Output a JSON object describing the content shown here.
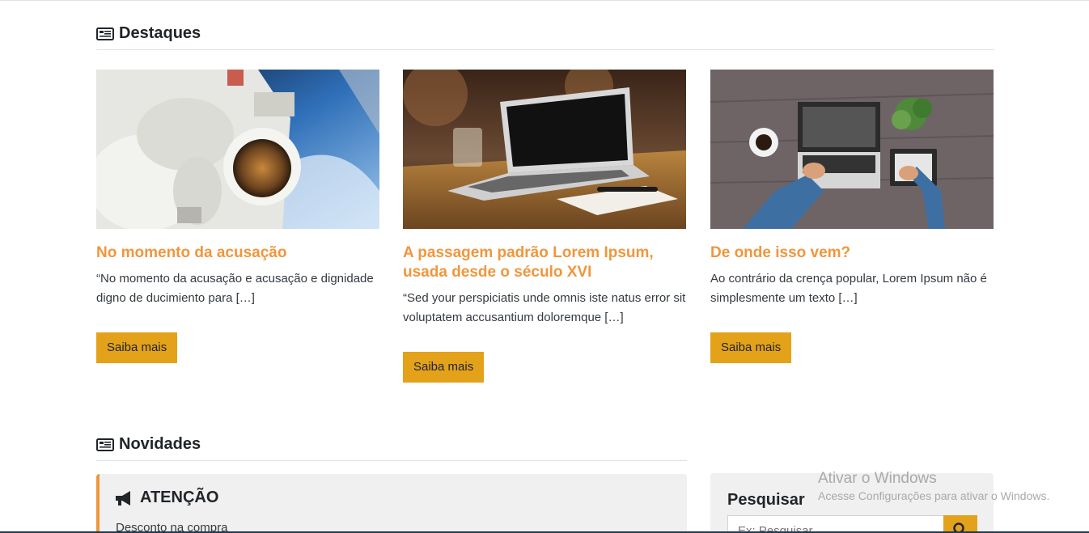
{
  "featured": {
    "title": "Destaques",
    "cards": [
      {
        "image": "astronaut-in-space-photo",
        "title": "No momento da acusação",
        "excerpt": "“No momento da acusação e acusação e dignidade digno de ducimiento para […]",
        "button": "Saiba mais"
      },
      {
        "image": "laptop-on-wooden-table-photo",
        "title": "A passagem padrão Lorem Ipsum, usada desde o século XVI",
        "excerpt": "“Sed your perspiciatis unde omnis iste natus error sit voluptatem accusantium doloremque […]",
        "button": "Saiba mais"
      },
      {
        "image": "desk-laptop-plant-coffee-photo",
        "title": "De onde isso vem?",
        "excerpt": "Ao contrário da crença popular, Lorem Ipsum não é simplesmente um texto […]",
        "button": "Saiba mais"
      }
    ]
  },
  "news": {
    "title": "Novidades",
    "alert": {
      "title": "ATENÇÃO",
      "text": "Desconto na compra"
    }
  },
  "search": {
    "title": "Pesquisar",
    "placeholder": "Ex: Pesquisar",
    "icon": "search-icon"
  },
  "watermark": {
    "line1": "Ativar o Windows",
    "line2": "Acesse Configurações para ativar o Windows."
  },
  "colors": {
    "accent": "#f0963c",
    "button": "#e3a21a",
    "panel": "#f0f0f0"
  }
}
